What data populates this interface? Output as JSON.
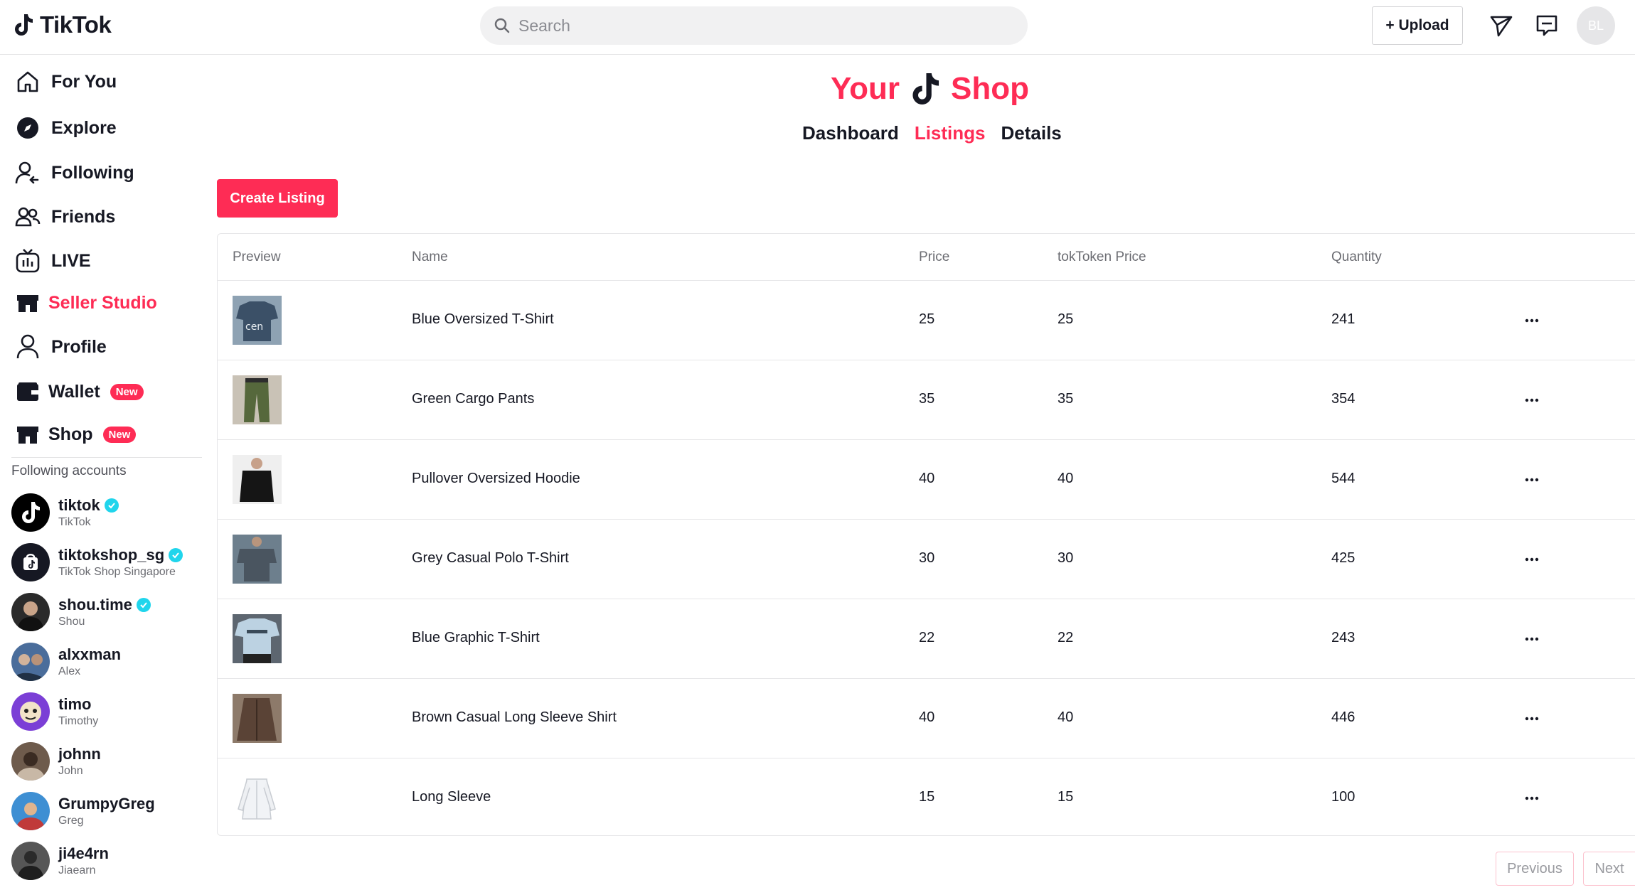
{
  "header": {
    "logo_text": "TikTok",
    "search_placeholder": "Search",
    "upload_label": "+ Upload",
    "avatar_initials": "BL"
  },
  "sidebar": {
    "items": [
      {
        "label": "For You",
        "icon": "home-icon"
      },
      {
        "label": "Explore",
        "icon": "compass-icon"
      },
      {
        "label": "Following",
        "icon": "following-icon"
      },
      {
        "label": "Friends",
        "icon": "friends-icon"
      },
      {
        "label": "LIVE",
        "icon": "live-icon"
      },
      {
        "label": "Seller Studio",
        "icon": "store-icon",
        "active": true
      },
      {
        "label": "Profile",
        "icon": "profile-icon"
      },
      {
        "label": "Wallet",
        "icon": "wallet-icon",
        "badge": "New"
      },
      {
        "label": "Shop",
        "icon": "shop-icon",
        "badge": "New"
      }
    ],
    "following_title": "Following accounts",
    "accounts": [
      {
        "username": "tiktok",
        "display": "TikTok",
        "verified": true
      },
      {
        "username": "tiktokshop_sg",
        "display": "TikTok Shop Singapore",
        "verified": true
      },
      {
        "username": "shou.time",
        "display": "Shou",
        "verified": true
      },
      {
        "username": "alxxman",
        "display": "Alex",
        "verified": false
      },
      {
        "username": "timo",
        "display": "Timothy",
        "verified": false
      },
      {
        "username": "johnn",
        "display": "John",
        "verified": false
      },
      {
        "username": "GrumpyGreg",
        "display": "Greg",
        "verified": false
      },
      {
        "username": "ji4e4rn",
        "display": "Jiaearn",
        "verified": false
      }
    ]
  },
  "main": {
    "title_left": "Your",
    "title_right": "Shop",
    "tabs": [
      {
        "label": "Dashboard",
        "active": false
      },
      {
        "label": "Listings",
        "active": true
      },
      {
        "label": "Details",
        "active": false
      }
    ],
    "create_label": "Create Listing",
    "columns": [
      "Preview",
      "Name",
      "Price",
      "tokToken Price",
      "Quantity"
    ],
    "rows": [
      {
        "name": "Blue Oversized T-Shirt",
        "price": "25",
        "tok_price": "25",
        "quantity": "241"
      },
      {
        "name": "Green Cargo Pants",
        "price": "35",
        "tok_price": "35",
        "quantity": "354"
      },
      {
        "name": "Pullover Oversized Hoodie",
        "price": "40",
        "tok_price": "40",
        "quantity": "544"
      },
      {
        "name": "Grey Casual Polo T-Shirt",
        "price": "30",
        "tok_price": "30",
        "quantity": "425"
      },
      {
        "name": "Blue Graphic T-Shirt",
        "price": "22",
        "tok_price": "22",
        "quantity": "243"
      },
      {
        "name": "Brown Casual Long Sleeve Shirt",
        "price": "40",
        "tok_price": "40",
        "quantity": "446"
      },
      {
        "name": "Long Sleeve",
        "price": "15",
        "tok_price": "15",
        "quantity": "100"
      }
    ],
    "pager": {
      "previous": "Previous",
      "next": "Next"
    }
  },
  "colors": {
    "accent": "#fe2c55",
    "verified": "#20d5ec"
  }
}
